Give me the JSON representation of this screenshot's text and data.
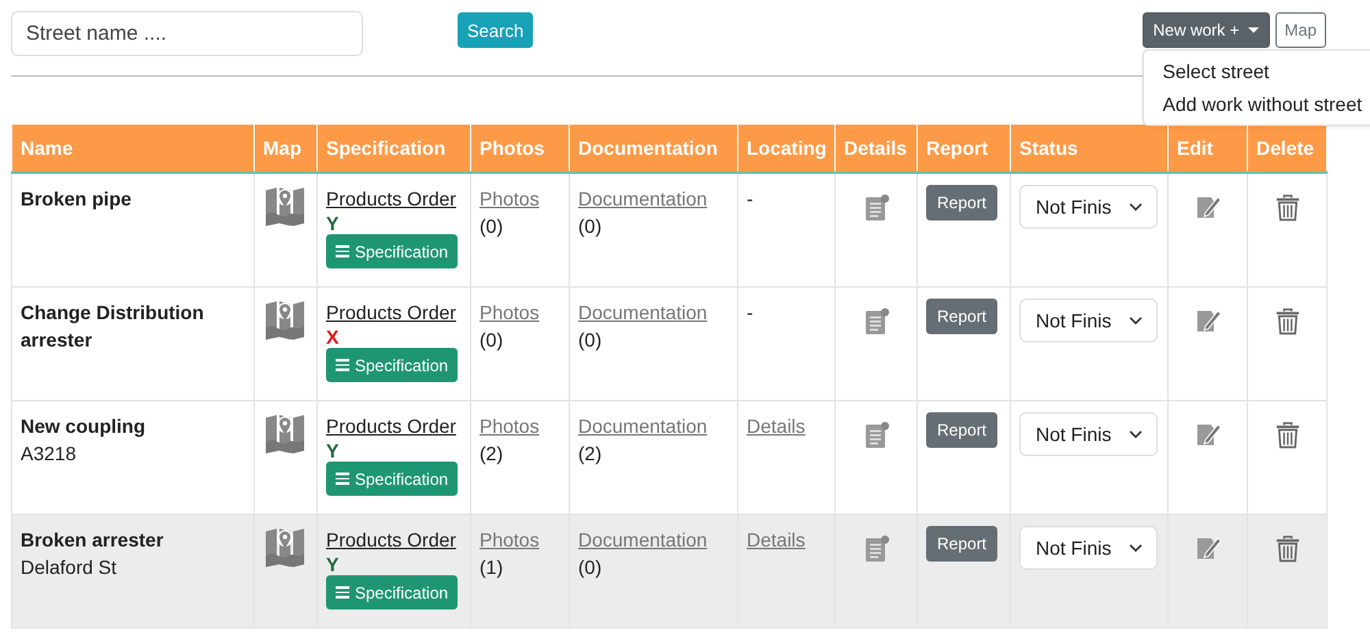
{
  "search": {
    "placeholder": "Street name ....",
    "button": "Search"
  },
  "new_work": {
    "label": "New work +",
    "expanded": true,
    "menu": [
      "Select street",
      "Add work without street"
    ]
  },
  "map_button": "Map",
  "table": {
    "columns": [
      "Name",
      "Map",
      "Specification",
      "Photos",
      "Documentation",
      "Locating",
      "Details",
      "Report",
      "Status",
      "Edit",
      "Delete"
    ],
    "rows": [
      {
        "name": "Broken pipe",
        "street": null,
        "order": "Products Order",
        "order_mark": "Y",
        "order_ok": true,
        "spec": "Specification",
        "photos": "Photos",
        "photos_count": "(0)",
        "docs": "Documentation",
        "docs_count": "(0)",
        "locating": {
          "kind": "text",
          "text": "-"
        },
        "report": "Report",
        "status": "Not Finis",
        "highlighted": false
      },
      {
        "name": "Change Distribution arrester",
        "street": null,
        "order": "Products Order",
        "order_mark": "X",
        "order_ok": false,
        "spec": "Specification",
        "photos": "Photos",
        "photos_count": "(0)",
        "docs": "Documentation",
        "docs_count": "(0)",
        "locating": {
          "kind": "text",
          "text": "-"
        },
        "report": "Report",
        "status": "Not Finis",
        "highlighted": false
      },
      {
        "name": "New coupling",
        "street": "A3218",
        "order": "Products Order",
        "order_mark": "Y",
        "order_ok": true,
        "spec": "Specification",
        "photos": "Photos",
        "photos_count": "(2)",
        "docs": "Documentation",
        "docs_count": "(2)",
        "locating": {
          "kind": "link",
          "text": "Details"
        },
        "report": "Report",
        "status": "Not Finis",
        "highlighted": false
      },
      {
        "name": "Broken arrester",
        "street": "Delaford St",
        "order": "Products Order",
        "order_mark": "Y",
        "order_ok": true,
        "spec": "Specification",
        "photos": "Photos",
        "photos_count": "(1)",
        "docs": "Documentation",
        "docs_count": "(0)",
        "locating": {
          "kind": "link",
          "text": "Details"
        },
        "report": "Report",
        "status": "Not Finis",
        "highlighted": true
      }
    ]
  }
}
